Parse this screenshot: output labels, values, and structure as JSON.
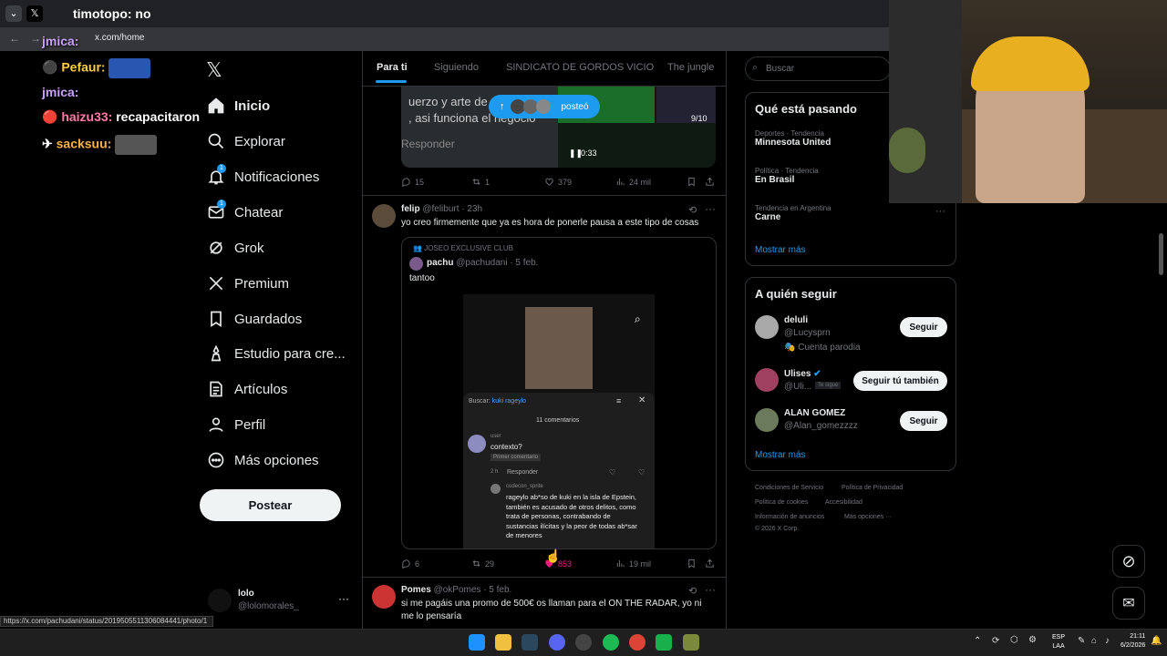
{
  "browser": {
    "tab_title": "timotopo: no",
    "url": "x.com/home",
    "status_url": "https://x.com/pachudani/status/2019505511306084441/photo/1"
  },
  "chat": [
    {
      "user": "jmica:",
      "text": ""
    },
    {
      "user": "Pefaur:",
      "text": ""
    },
    {
      "user": "jmica:",
      "text": ""
    },
    {
      "user": "haizu33:",
      "text": "recapacitaron"
    },
    {
      "user": "sacksuu:",
      "text": ""
    }
  ],
  "nav": {
    "items": [
      {
        "label": "Inicio",
        "icon": "home-icon"
      },
      {
        "label": "Explorar",
        "icon": "search-icon"
      },
      {
        "label": "Notificaciones",
        "icon": "bell-icon"
      },
      {
        "label": "Chatear",
        "icon": "mail-icon"
      },
      {
        "label": "Grok",
        "icon": "grok-icon"
      },
      {
        "label": "Premium",
        "icon": "x-logo-icon"
      },
      {
        "label": "Guardados",
        "icon": "bookmark-icon"
      },
      {
        "label": "Estudio para cre...",
        "icon": "studio-icon"
      },
      {
        "label": "Artículos",
        "icon": "article-icon"
      },
      {
        "label": "Perfil",
        "icon": "person-icon"
      },
      {
        "label": "Más opciones",
        "icon": "more-circle-icon"
      }
    ],
    "post_label": "Postear",
    "account_name": "lolo",
    "account_handle": "@lolomorales_"
  },
  "tabs": [
    "Para ti",
    "Siguiendo",
    "SINDICATO DE GORDOS VICIO",
    "The jungle"
  ],
  "posted_pill": "posteó",
  "tweet1": {
    "caption_lines": [
      "uerzo y arte de",
      ", asi funciona el negocio"
    ],
    "reply_label": "Responder",
    "video_time": "0:33",
    "counter": "9/10",
    "replies": "15",
    "reposts": "1",
    "likes": "379",
    "views": "24 mil"
  },
  "tweet2": {
    "name": "felip",
    "handle": "@feliburt · 23h",
    "text": "yo creo firmemente que ya es hora de ponerle pausa a este tipo de cosas",
    "quote": {
      "community": "JOSEO EXCLUSIVE CLUB",
      "name": "pachu",
      "handle": "@pachudani · 5 feb.",
      "text": "tantoo",
      "search_prefix": "Buscar:",
      "search_term": "kuki rageylo",
      "comments_count": "11 comentarios",
      "comment1_user": "user",
      "comment1_text": "contexto?",
      "comment1_tag": "Primer comentario",
      "comment1_time": "2 h",
      "comment1_reply": "Responder",
      "comment2_user": "codecon_sprite",
      "comment2_text": "rageylo ab*so de kuki en la isla de Epstein, también es acusado de otros delitos, como trata de personas, contrabando de sustancias ilícitas y la peor de todas ab*sar de menores"
    },
    "replies": "6",
    "reposts": "29",
    "likes": "853",
    "views": "19 mil"
  },
  "tweet3": {
    "name": "Pomes",
    "handle": "@okPomes · 5 feb.",
    "text": "si me pagáis una promo de 500€ os llaman para el ON THE RADAR, yo ni me lo pensaría"
  },
  "right": {
    "search_placeholder": "Buscar",
    "trends_title": "Qué está pasando",
    "trends": [
      {
        "category": "Deportes · Tendencia",
        "name": "Minnesota United"
      },
      {
        "category": "Política · Tendencia",
        "name": "En Brasil"
      },
      {
        "category": "Tendencia en Argentina",
        "name": "Carne"
      }
    ],
    "show_more": "Mostrar más",
    "follow_title": "A quién seguir",
    "follow": [
      {
        "name": "deluli",
        "handle": "@Lucysprn",
        "extra": "Cuenta parodia",
        "button": "Seguir"
      },
      {
        "name": "Ulises",
        "handle": "@Uli...",
        "extra": "Te sigue",
        "button": "Seguir tú también"
      },
      {
        "name": "ALAN GOMEZ",
        "handle": "@Alan_gomezzzz",
        "extra": "",
        "button": "Seguir"
      }
    ],
    "footer": [
      "Condiciones de Servicio",
      "Política de Privacidad",
      "Política de cookies",
      "Accesibilidad",
      "Información de anuncios",
      "Más opciones ···",
      "© 2026 X Corp."
    ]
  },
  "taskbar": {
    "lang": "ESP",
    "lang2": "LAA",
    "time": "21:11",
    "date": "6/2/2026"
  }
}
